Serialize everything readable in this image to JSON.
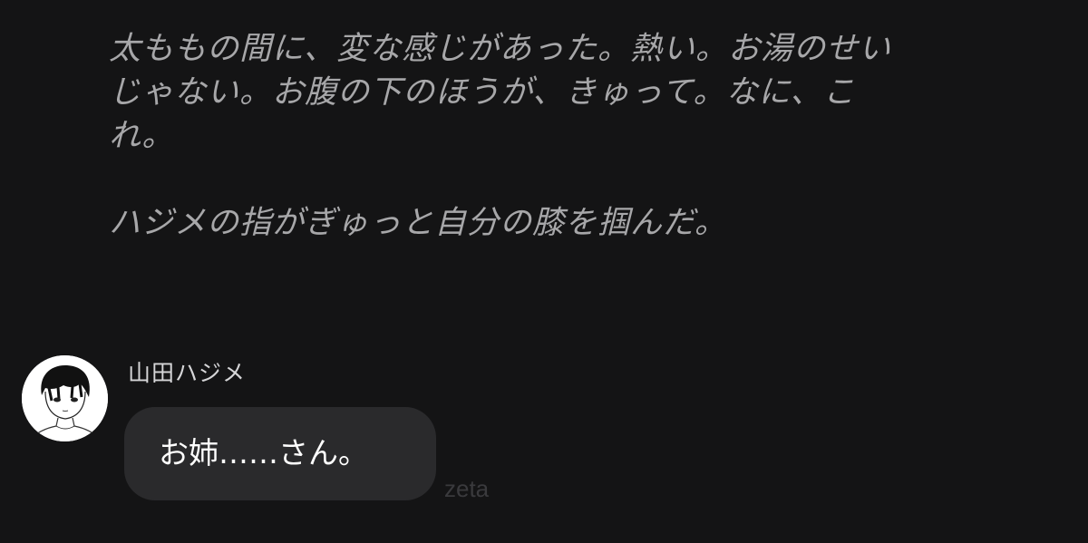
{
  "narration": {
    "paragraph1_line1": "太ももの間に、変な感じがあった。熱い。お湯のせい",
    "paragraph1_line2": "じゃない。お腹の下のほうが、きゅって。なに、こ",
    "paragraph1_line3": "れ。",
    "paragraph2": "ハジメの指がぎゅっと自分の膝を掴んだ。"
  },
  "message": {
    "sender_name": "山田ハジメ",
    "avatar_icon": "character-avatar-icon",
    "text": "お姉……さん。"
  },
  "watermark": {
    "label": "zeta"
  },
  "colors": {
    "background": "#141415",
    "narration_text": "#a7a7a9",
    "bubble_background": "#2a2a2c",
    "bubble_text": "#ffffff",
    "watermark": "#3a3a3d"
  }
}
